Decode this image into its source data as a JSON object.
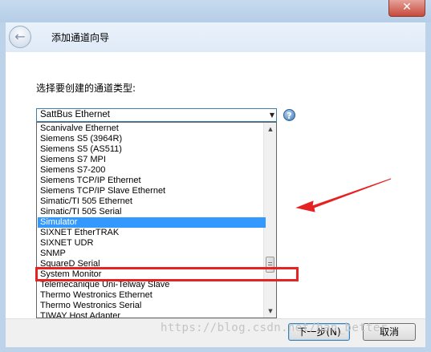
{
  "window": {
    "close_glyph": "✕"
  },
  "header": {
    "back_glyph": "←",
    "title": "添加通道向导"
  },
  "main": {
    "prompt": "选择要创建的通道类型:",
    "combo_value": "SattBus Ethernet",
    "help_glyph": "?",
    "options": [
      "Scanivalve Ethernet",
      "Siemens S5 (3964R)",
      "Siemens S5 (AS511)",
      "Siemens S7 MPI",
      "Siemens S7-200",
      "Siemens TCP/IP Ethernet",
      "Siemens TCP/IP Slave Ethernet",
      "Simatic/TI 505 Ethernet",
      "Simatic/TI 505 Serial",
      "Simulator",
      "SIXNET EtherTRAK",
      "SIXNET UDR",
      "SNMP",
      "SquareD Serial",
      "System Monitor",
      "Telemecanique Uni-Telway Slave",
      "Thermo Westronics Ethernet",
      "Thermo Westronics Serial",
      "TIWAY Host Adapter"
    ],
    "selected_index": 9
  },
  "footer": {
    "next_label": "下一步(N)",
    "cancel_label": "取消"
  },
  "watermark": "https://blog.csdn.net/han_better",
  "colors": {
    "selection": "#3399ff",
    "annotation": "#e52322"
  }
}
